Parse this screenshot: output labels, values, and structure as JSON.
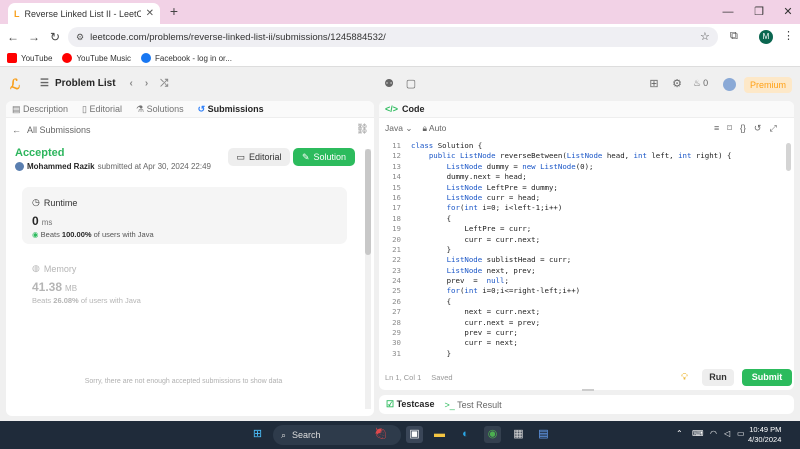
{
  "browser": {
    "tab_title": "Reverse Linked List II - LeetCod",
    "url": "leetcode.com/problems/reverse-linked-list-ii/submissions/1245884532/",
    "profile_initial": "M",
    "bookmarks": [
      {
        "label": "YouTube",
        "color": "#ff0000"
      },
      {
        "label": "YouTube Music",
        "color": "#ff0000"
      },
      {
        "label": "Facebook - log in or...",
        "color": "#1877f2"
      }
    ]
  },
  "lc_header": {
    "problem_list": "Problem List",
    "streak": "0",
    "premium": "Premium"
  },
  "left_tabs": [
    {
      "label": "Description",
      "active": false
    },
    {
      "label": "Editorial",
      "active": false
    },
    {
      "label": "Solutions",
      "active": false
    },
    {
      "label": "Submissions",
      "active": true
    }
  ],
  "submission": {
    "back_label": "All Submissions",
    "status": "Accepted",
    "author": "Mohammed Razik",
    "submitted_at": "submitted at Apr 30, 2024 22:49",
    "editorial_btn": "Editorial",
    "solution_btn": "Solution",
    "runtime": {
      "title": "Runtime",
      "value": "0",
      "unit": "ms",
      "beats_pct": "100.00%",
      "beats_text": "of users with Java",
      "beats_prefix": "Beats"
    },
    "memory": {
      "title": "Memory",
      "value": "41.38",
      "unit": "MB",
      "beats_pct": "26.08%",
      "beats_text": "of users with Java",
      "beats_prefix": "Beats"
    },
    "no_submissions_msg": "Sorry, there are not enough accepted submissions to show data"
  },
  "code_panel": {
    "title": "Code",
    "language": "Java",
    "mode": "Auto",
    "cursor": "Ln 1, Col 1",
    "saved": "Saved",
    "lines": [
      {
        "no": "11",
        "text": "class Solution {"
      },
      {
        "no": "12",
        "text": "    public ListNode reverseBetween(ListNode head, int left, int right) {"
      },
      {
        "no": "13",
        "text": "        ListNode dummy = new ListNode(0);"
      },
      {
        "no": "14",
        "text": "        dummy.next = head;"
      },
      {
        "no": "15",
        "text": "        ListNode LeftPre = dummy;"
      },
      {
        "no": "16",
        "text": "        ListNode curr = head;"
      },
      {
        "no": "17",
        "text": "        for(int i=0; i<left-1;i++)"
      },
      {
        "no": "18",
        "text": "        {"
      },
      {
        "no": "19",
        "text": "            LeftPre = curr;"
      },
      {
        "no": "20",
        "text": "            curr = curr.next;"
      },
      {
        "no": "21",
        "text": "        }"
      },
      {
        "no": "22",
        "text": "        ListNode sublistHead = curr;"
      },
      {
        "no": "23",
        "text": "        ListNode next, prev;"
      },
      {
        "no": "24",
        "text": "        prev  =  null;"
      },
      {
        "no": "25",
        "text": "        for(int i=0;i<=right-left;i++)"
      },
      {
        "no": "26",
        "text": "        {"
      },
      {
        "no": "27",
        "text": "            next = curr.next;"
      },
      {
        "no": "28",
        "text": "            curr.next = prev;"
      },
      {
        "no": "29",
        "text": "            prev = curr;"
      },
      {
        "no": "30",
        "text": "            curr = next;"
      },
      {
        "no": "31",
        "text": "        }"
      }
    ],
    "run": "Run",
    "submit": "Submit"
  },
  "testbar": {
    "testcase": "Testcase",
    "result": "Test Result"
  },
  "taskbar": {
    "search": "Search",
    "time": "10:49 PM",
    "date": "4/30/2024"
  }
}
